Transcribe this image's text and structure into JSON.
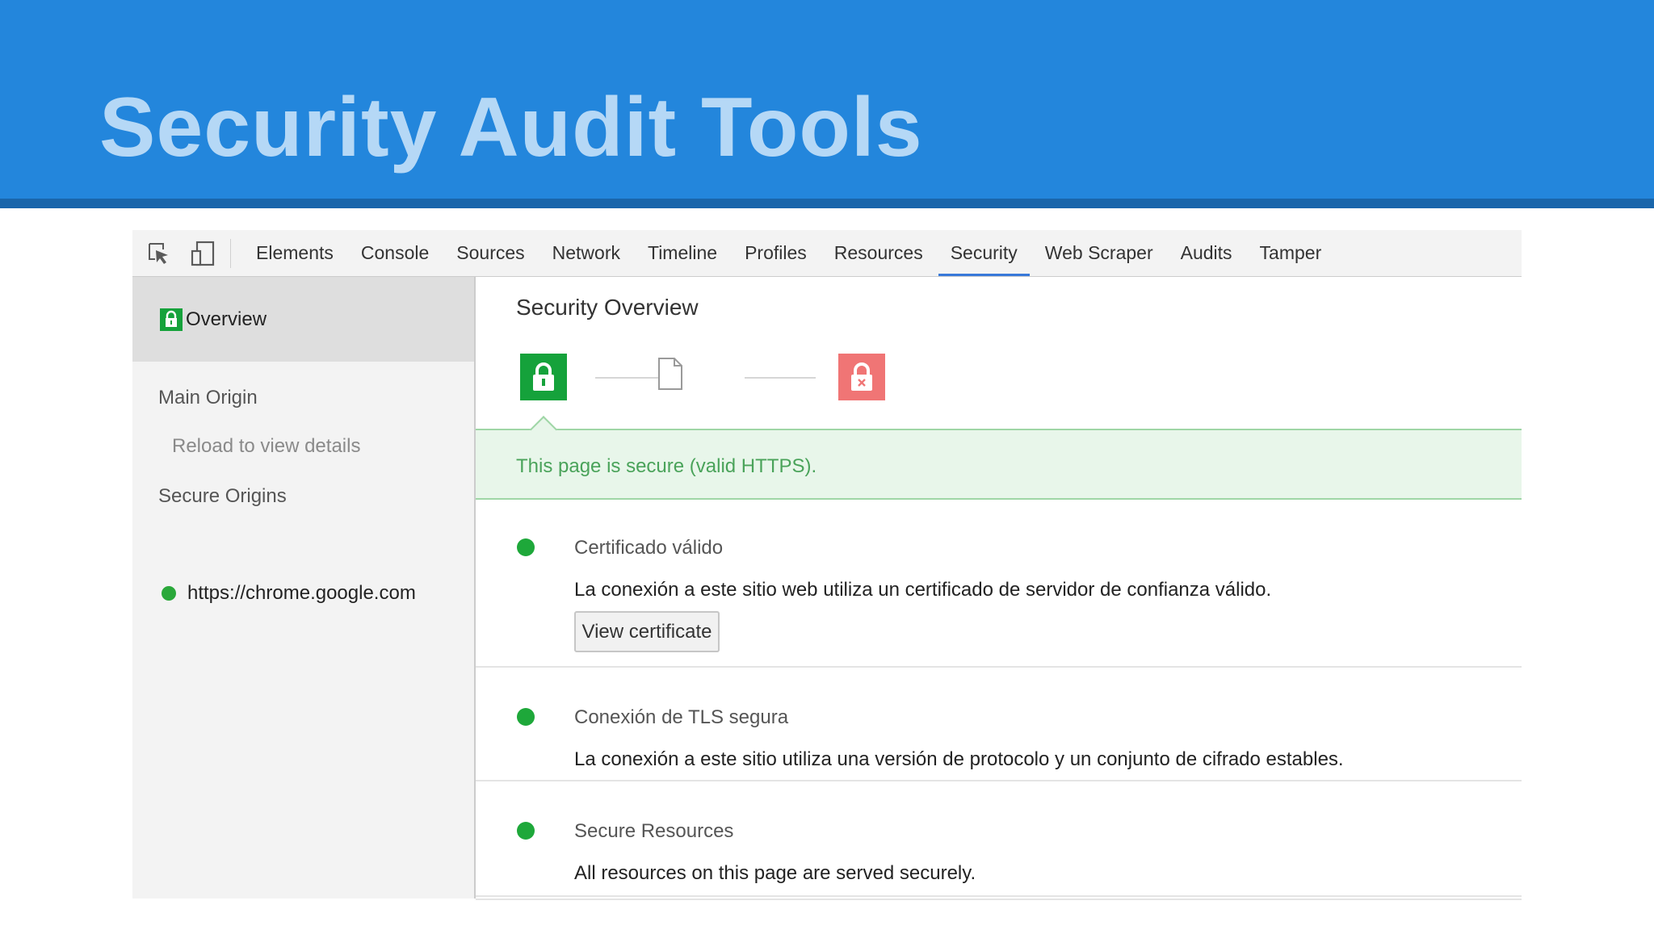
{
  "slide": {
    "title": "Security Audit Tools",
    "colors": {
      "header": "#2386dc",
      "header_rule": "#1a66ab",
      "title_text": "#b5d8f6"
    }
  },
  "toolbar": {
    "icons": [
      "inspect-element-icon",
      "device-mode-icon"
    ],
    "tabs": [
      {
        "label": "Elements",
        "active": false
      },
      {
        "label": "Console",
        "active": false
      },
      {
        "label": "Sources",
        "active": false
      },
      {
        "label": "Network",
        "active": false
      },
      {
        "label": "Timeline",
        "active": false
      },
      {
        "label": "Profiles",
        "active": false
      },
      {
        "label": "Resources",
        "active": false
      },
      {
        "label": "Security",
        "active": true
      },
      {
        "label": "Web Scraper",
        "active": false
      },
      {
        "label": "Audits",
        "active": false
      },
      {
        "label": "Tamper",
        "active": false
      }
    ]
  },
  "sidebar": {
    "overview_label": "Overview",
    "main_origin_heading": "Main Origin",
    "reload_hint": "Reload to view details",
    "secure_origins_heading": "Secure Origins",
    "origins": [
      {
        "url": "https://chrome.google.com",
        "status": "secure"
      }
    ]
  },
  "main": {
    "title": "Security Overview",
    "summary_icons": [
      "secure-lock-icon",
      "info-document-icon",
      "insecure-lock-icon"
    ],
    "banner_text": "This page is secure (valid HTTPS).",
    "items": [
      {
        "title": "Certificado válido",
        "description": "La conexión a este sitio web utiliza un certificado de servidor de confianza válido.",
        "button_label": "View certificate"
      },
      {
        "title": "Conexión de TLS segura",
        "description": "La conexión a este sitio utiliza una versión de protocolo y un conjunto de cifrado estables."
      },
      {
        "title": "Secure Resources",
        "description": "All resources on this page are served securely."
      }
    ],
    "colors": {
      "secure": "#15a23b",
      "insecure": "#f07575",
      "banner_bg": "#e8f6ea",
      "banner_text": "#4aa35a",
      "active_tab": "#3879d9"
    }
  }
}
